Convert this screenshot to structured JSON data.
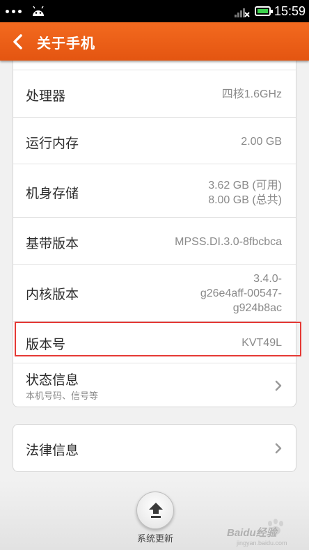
{
  "status_bar": {
    "time": "15:59"
  },
  "header": {
    "title": "关于手机"
  },
  "about": {
    "rows": [
      {
        "label": "处理器",
        "value": "四核1.6GHz"
      },
      {
        "label": "运行内存",
        "value": "2.00 GB"
      },
      {
        "label": "机身存储",
        "value_lines": [
          "3.62 GB (可用)",
          "8.00 GB (总共)"
        ]
      },
      {
        "label": "基带版本",
        "value": "MPSS.DI.3.0-8fbcbca"
      },
      {
        "label": "内核版本",
        "value_lines": [
          "3.4.0-",
          "g26e4aff-00547-",
          "g924b8ac"
        ]
      },
      {
        "label": "版本号",
        "value": "KVT49L"
      },
      {
        "label": "状态信息",
        "subtitle": "本机号码、信号等"
      }
    ]
  },
  "legal": {
    "label": "法律信息"
  },
  "system_update": {
    "label": "系统更新"
  },
  "watermark": {
    "text": "Baidu经验",
    "url": "jingyan.baidu.com"
  },
  "colors": {
    "title_bar": "#ea5a17",
    "highlight": "#e53935",
    "battery": "#3cd14c"
  }
}
